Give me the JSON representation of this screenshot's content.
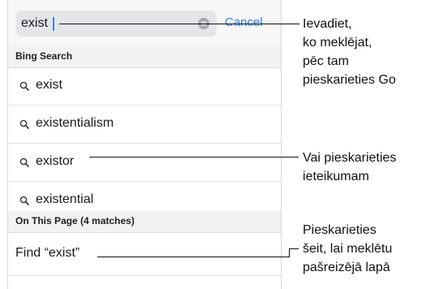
{
  "search": {
    "value": "exist",
    "cancel_label": "Cancel"
  },
  "sections": {
    "bing_header": "Bing Search",
    "page_header": "On This Page (4 matches)"
  },
  "suggestions": [
    {
      "label": "exist",
      "icon": "search-icon"
    },
    {
      "label": "existentialism",
      "icon": "search-icon"
    },
    {
      "label": "existor",
      "icon": "search-icon"
    },
    {
      "label": "existential",
      "icon": "search-icon"
    }
  ],
  "find_row": {
    "label": "Find “exist”"
  },
  "callouts": {
    "type_search": [
      "Ievadiet,",
      "ko meklējat,",
      "pēc tam",
      "pieskarieties Go"
    ],
    "tap_suggestion": [
      "Vai pieskarieties",
      "ieteikumam"
    ],
    "find_on_page": [
      "Pieskarieties",
      "šeit, lai meklētu",
      "pašreizējā lapā"
    ]
  },
  "colors": {
    "accent": "#2a7fe0",
    "caret": "#3b8ddb"
  }
}
